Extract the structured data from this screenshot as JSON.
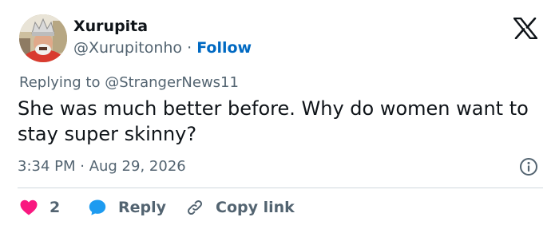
{
  "author": {
    "display_name": "Xurupita",
    "handle": "@Xurupitonho",
    "separator": "·",
    "follow_label": "Follow"
  },
  "tweet": {
    "replying_to": "Replying to @StrangerNews11",
    "text": "She was much better before. Why do women want to stay super skinny?",
    "timestamp": "3:34 PM · Aug 29, 2026"
  },
  "actions": {
    "like_count": "2",
    "reply_label": "Reply",
    "copy_link_label": "Copy link"
  },
  "colors": {
    "like": "#f91880",
    "reply": "#1d9bf0",
    "follow": "#0069c2",
    "secondary_text": "#536471"
  },
  "icons": {
    "brand": "x-logo-icon",
    "info": "info-icon",
    "like": "heart-icon",
    "reply": "speech-bubble-icon",
    "copy": "link-icon"
  }
}
